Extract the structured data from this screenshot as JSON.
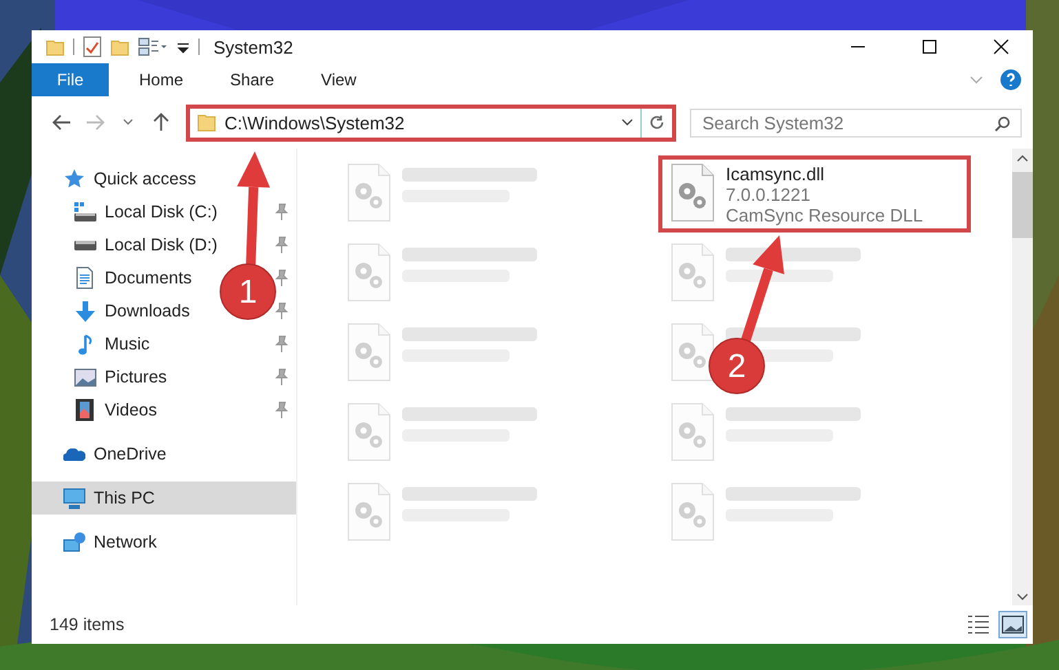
{
  "window": {
    "title": "System32"
  },
  "ribbon_tabs": [
    {
      "label": "File",
      "kind": "file"
    },
    {
      "label": "Home",
      "kind": "tab"
    },
    {
      "label": "Share",
      "kind": "tab"
    },
    {
      "label": "View",
      "kind": "tab"
    }
  ],
  "address": {
    "path": "C:\\Windows\\System32",
    "highlighted": true
  },
  "search": {
    "placeholder": "Search System32"
  },
  "sidebar": {
    "items": [
      {
        "label": "Quick access",
        "kind": "star",
        "selected": false,
        "children": [
          {
            "label": "Local Disk (C:)",
            "kind": "system-drive",
            "pinned": true,
            "selected": false
          },
          {
            "label": "Local Disk (D:)",
            "kind": "drive",
            "pinned": true,
            "selected": false
          },
          {
            "label": "Documents",
            "kind": "document",
            "pinned": true,
            "selected": false
          },
          {
            "label": "Downloads",
            "kind": "download",
            "pinned": true,
            "selected": false
          },
          {
            "label": "Music",
            "kind": "music",
            "pinned": true,
            "selected": false
          },
          {
            "label": "Pictures",
            "kind": "pictures",
            "pinned": true,
            "selected": false
          },
          {
            "label": "Videos",
            "kind": "video",
            "pinned": true,
            "selected": false
          }
        ]
      },
      {
        "label": "OneDrive",
        "kind": "cloud",
        "selected": false
      },
      {
        "label": "This PC",
        "kind": "computer",
        "selected": true
      },
      {
        "label": "Network",
        "kind": "network",
        "selected": false
      }
    ]
  },
  "files": [
    {
      "blurred": true,
      "highlighted": false
    },
    {
      "name": "Icamsync.dll",
      "version": "7.0.0.1221",
      "description": "CamSync Resource DLL",
      "blurred": false,
      "highlighted": true
    },
    {
      "blurred": true,
      "highlighted": false
    },
    {
      "blurred": true,
      "highlighted": false
    },
    {
      "blurred": true,
      "highlighted": false
    },
    {
      "blurred": true,
      "highlighted": false
    },
    {
      "blurred": true,
      "highlighted": false
    },
    {
      "blurred": true,
      "highlighted": false
    },
    {
      "blurred": true,
      "highlighted": false
    },
    {
      "blurred": true,
      "highlighted": false
    }
  ],
  "status_bar": {
    "item_count": "149 items"
  },
  "view_buttons": [
    {
      "kind": "details",
      "selected": false
    },
    {
      "kind": "tiles",
      "selected": true
    }
  ],
  "annotations": [
    {
      "label": "1"
    },
    {
      "label": "2"
    }
  ]
}
